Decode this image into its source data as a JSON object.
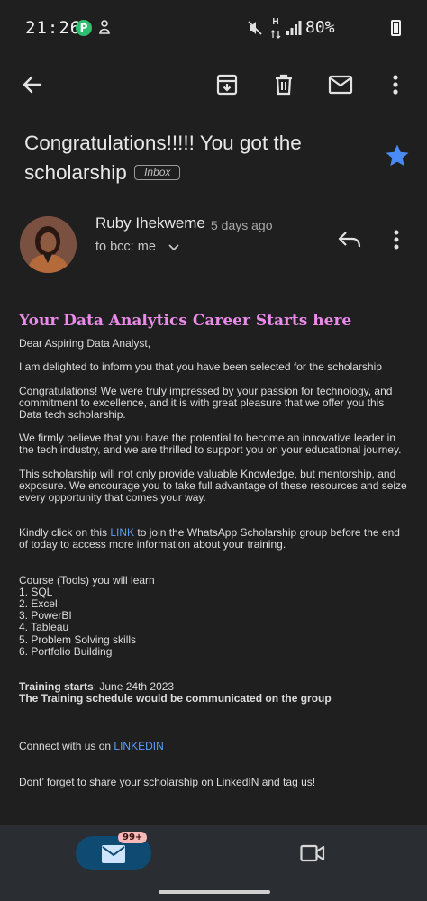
{
  "status_bar": {
    "time": "21:26",
    "p_icon_letter": "P",
    "network_label": "H",
    "battery_text": "80%"
  },
  "toolbar": {
    "icons": [
      "back-arrow-icon",
      "archive-icon",
      "delete-icon",
      "mark-unread-icon",
      "more-vert-icon"
    ]
  },
  "email": {
    "subject": "Congratulations!!!!! You got the scholarship",
    "label": "Inbox",
    "starred": true,
    "sender_name": "Ruby Ihekweme",
    "sent_time": "5 days ago",
    "recipients": "to bcc: me",
    "heading": "Your Data Analytics Career Starts here",
    "greeting": "Dear Aspiring Data Analyst,",
    "para1": "I am delighted to inform you that you have been selected for the scholarship",
    "para2": "Congratulations! We were truly impressed by your passion for technology, and commitment to excellence, and it is with great pleasure that we offer you this Data tech scholarship.",
    "para3": "We firmly believe that you have the potential to become an innovative leader in the tech industry, and we are thrilled to support you on your educational journey.",
    "para4": "This scholarship will not only provide valuable Knowledge, but mentorship, and exposure. We encourage you to take full advantage of these resources and seize every opportunity that comes your way.",
    "kindly_prefix": "Kindly click on this ",
    "kindly_link": "LINK",
    "kindly_suffix": " to join the WhatsApp Scholarship group before the end of today to access more information about your training.",
    "course_title": "Course (Tools) you will learn",
    "courses": [
      "1. SQL",
      "2. Excel",
      "3. PowerBI",
      "4. Tableau",
      "5. Problem Solving skills",
      "6. Portfolio Building"
    ],
    "training_label": "Training starts",
    "training_date": ": June 24th 2023",
    "schedule_note": "The Training schedule would be communicated on the group",
    "connect_prefix": "Connect with us on ",
    "connect_link": "LINKEDIN",
    "closing": "Dont’ forget to share your scholarship on LinkedIN and tag us!"
  },
  "bottom_nav": {
    "mail_badge": "99+",
    "active_tab": "mail",
    "accent_color": "#0f4a73"
  },
  "colors": {
    "background": "#1f1f1f",
    "heading": "#e98be8",
    "link": "#5b9cf5",
    "star": "#4a8af4"
  }
}
